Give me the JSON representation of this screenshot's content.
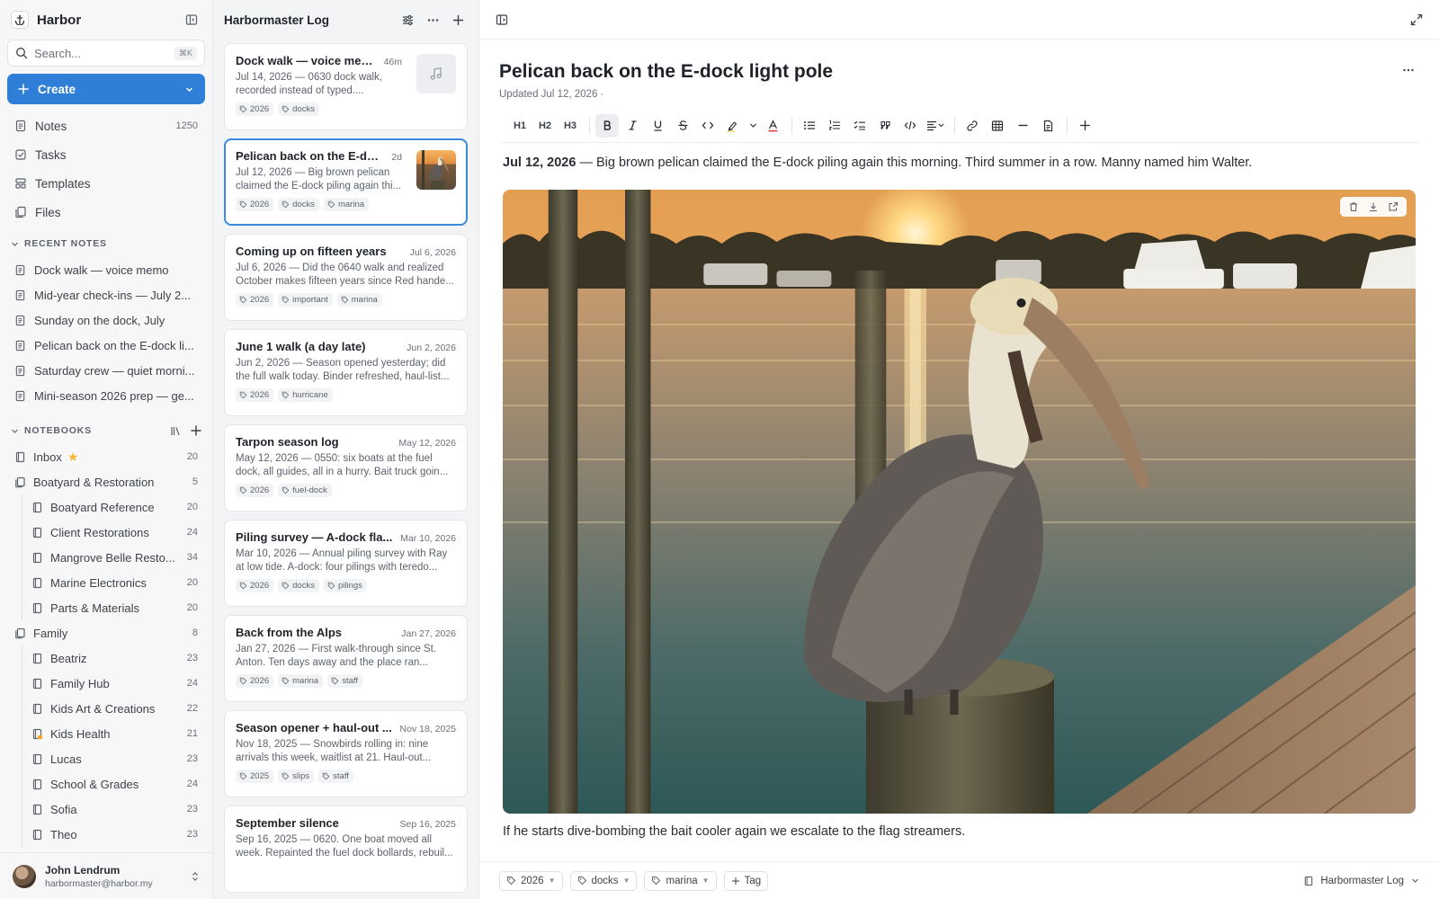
{
  "app": {
    "title": "Harbor"
  },
  "search": {
    "placeholder": "Search...",
    "shortcut": "⌘K"
  },
  "create": {
    "label": "Create"
  },
  "nav": [
    {
      "label": "Notes",
      "count": "1250",
      "icon": "notes-icon"
    },
    {
      "label": "Tasks",
      "count": "",
      "icon": "tasks-icon"
    },
    {
      "label": "Templates",
      "count": "",
      "icon": "templates-icon"
    },
    {
      "label": "Files",
      "count": "",
      "icon": "files-icon"
    }
  ],
  "recent": {
    "heading": "RECENT NOTES",
    "items": [
      "Dock walk — voice memo",
      "Mid-year check-ins — July 2...",
      "Sunday on the dock, July",
      "Pelican back on the E-dock li...",
      "Saturday crew — quiet morni...",
      "Mini-season 2026 prep — ge..."
    ]
  },
  "notebooks": {
    "heading": "NOTEBOOKS",
    "inbox": {
      "label": "Inbox",
      "count": "20"
    },
    "groups": [
      {
        "label": "Boatyard & Restoration",
        "count": "5",
        "children": [
          {
            "label": "Boatyard Reference",
            "count": "20"
          },
          {
            "label": "Client Restorations",
            "count": "24"
          },
          {
            "label": "Mangrove Belle Resto...",
            "count": "34"
          },
          {
            "label": "Marine Electronics",
            "count": "20"
          },
          {
            "label": "Parts & Materials",
            "count": "20"
          }
        ]
      },
      {
        "label": "Family",
        "count": "8",
        "children": [
          {
            "label": "Beatriz",
            "count": "23"
          },
          {
            "label": "Family Hub",
            "count": "24"
          },
          {
            "label": "Kids Art & Creations",
            "count": "22"
          },
          {
            "label": "Kids Health",
            "count": "21"
          },
          {
            "label": "Lucas",
            "count": "23"
          },
          {
            "label": "School & Grades",
            "count": "24"
          },
          {
            "label": "Sofia",
            "count": "23"
          },
          {
            "label": "Theo",
            "count": "23"
          }
        ]
      }
    ]
  },
  "user": {
    "name": "John Lendrum",
    "email": "harbormaster@harbor.my"
  },
  "list": {
    "title": "Harbormaster Log",
    "notes": [
      {
        "title": "Dock walk — voice memo",
        "date": "46m",
        "body": "Jul 14, 2026 — 0630 dock walk, recorded instead of typed....",
        "tags": [
          "2026",
          "docks"
        ],
        "thumb": "audio"
      },
      {
        "title": "Pelican back on the E-doc...",
        "date": "2d",
        "body": "Jul 12, 2026 — Big brown pelican claimed the E-dock piling again thi...",
        "tags": [
          "2026",
          "docks",
          "marina"
        ],
        "thumb": "image",
        "selected": true
      },
      {
        "title": "Coming up on fifteen years",
        "date": "Jul 6, 2026",
        "body": "Jul 6, 2026 — Did the 0640 walk and realized October makes fifteen years since Red hande...",
        "tags": [
          "2026",
          "important",
          "marina"
        ]
      },
      {
        "title": "June 1 walk (a day late)",
        "date": "Jun 2, 2026",
        "body": "Jun 2, 2026 — Season opened yesterday; did the full walk today. Binder refreshed, haul-list...",
        "tags": [
          "2026",
          "hurricane"
        ]
      },
      {
        "title": "Tarpon season log",
        "date": "May 12, 2026",
        "body": "May 12, 2026 — 0550: six boats at the fuel dock, all guides, all in a hurry. Bait truck goin...",
        "tags": [
          "2026",
          "fuel-dock"
        ]
      },
      {
        "title": "Piling survey — A-dock fla...",
        "date": "Mar 10, 2026",
        "body": "Mar 10, 2026 — Annual piling survey with Ray at low tide. A-dock: four pilings with teredo...",
        "tags": [
          "2026",
          "docks",
          "pilings"
        ]
      },
      {
        "title": "Back from the Alps",
        "date": "Jan 27, 2026",
        "body": "Jan 27, 2026 — First walk-through since St. Anton. Ten days away and the place ran...",
        "tags": [
          "2026",
          "marina",
          "staff"
        ]
      },
      {
        "title": "Season opener + haul-out ...",
        "date": "Nov 18, 2025",
        "body": "Nov 18, 2025 — Snowbirds rolling in: nine arrivals this week, waitlist at 21. Haul-out...",
        "tags": [
          "2025",
          "slips",
          "staff"
        ]
      },
      {
        "title": "September silence",
        "date": "Sep 16, 2025",
        "body": "Sep 16, 2025 — 0620. One boat moved all week. Repainted the fuel dock bollards, rebuil...",
        "tags": []
      }
    ]
  },
  "doc": {
    "title": "Pelican back on the E-dock light pole",
    "updated": "Updated Jul 12, 2026  ·",
    "lead_date": "Jul 12, 2026",
    "lead_text": " — Big brown pelican claimed the E-dock piling again this morning. Third summer in a row. Manny named him Walter.",
    "caption": "If he starts dive-bombing the bait cooler again we escalate to the flag streamers.",
    "tags": [
      "2026",
      "docks",
      "marina"
    ],
    "add_tag": "Tag",
    "notebook": "Harbormaster Log"
  },
  "toolbar": {
    "h1": "H1",
    "h2": "H2",
    "h3": "H3"
  },
  "colors": {
    "accent": "#2f7fd9",
    "selected_border": "#3a8be0",
    "star": "#f5b82e"
  }
}
